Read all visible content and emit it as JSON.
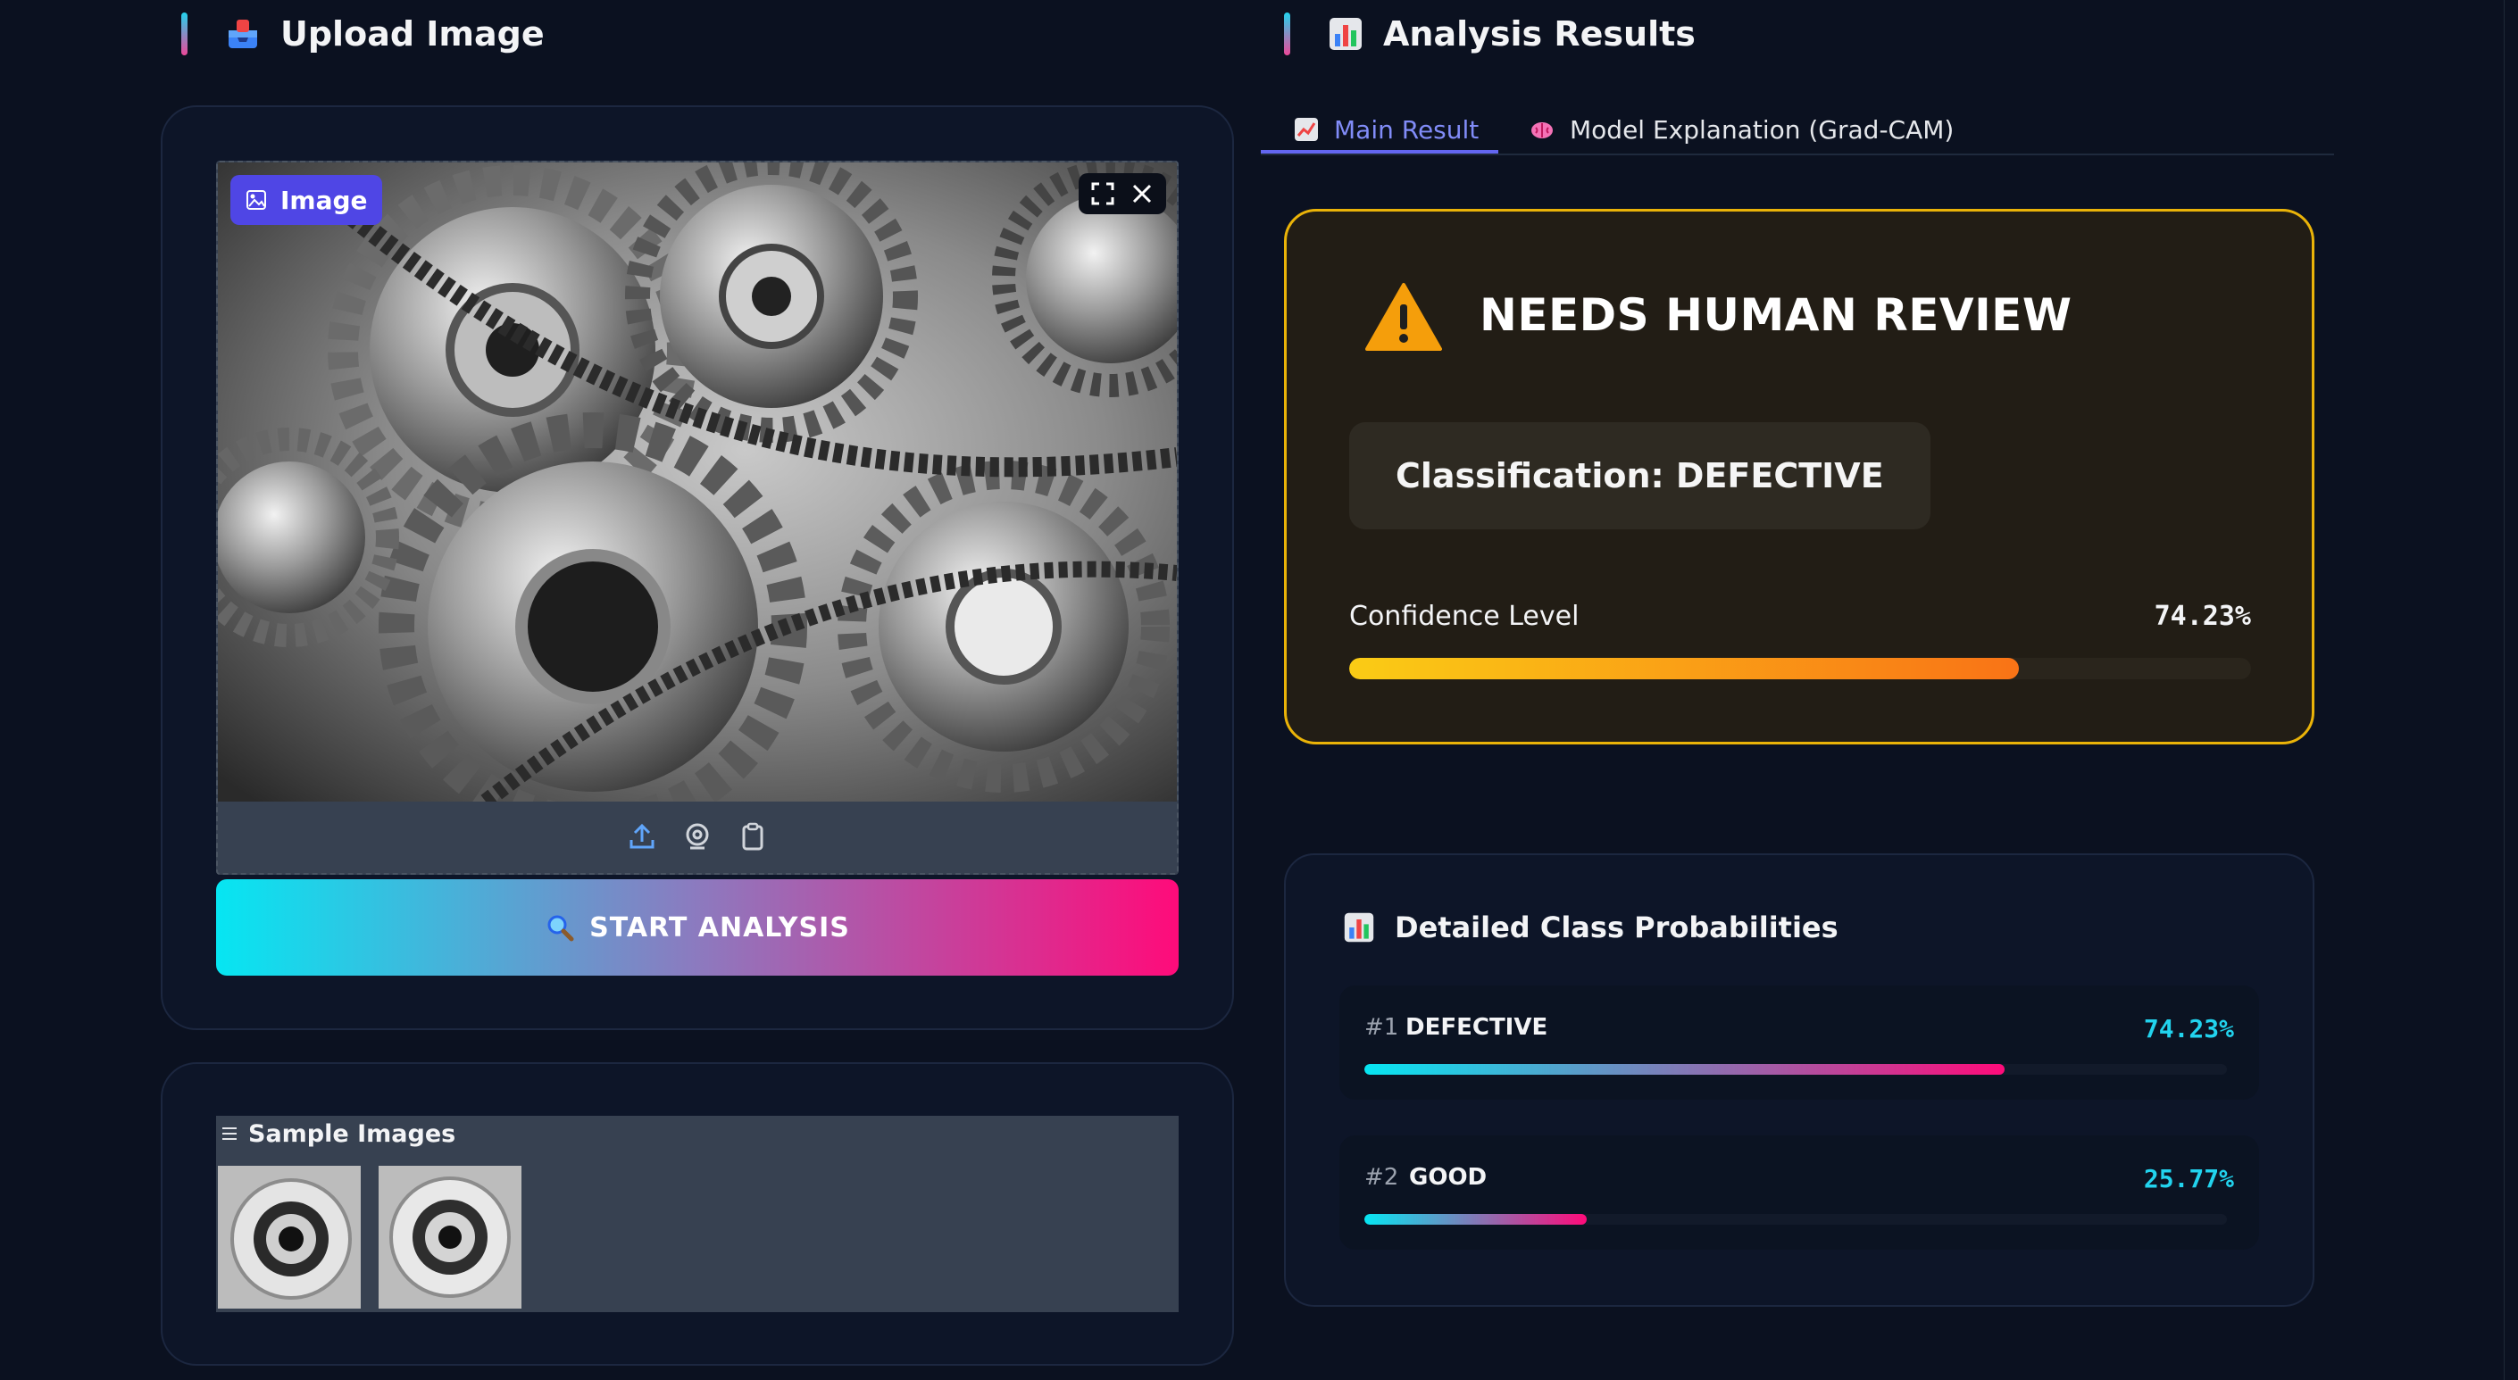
{
  "upload": {
    "title": "Upload Image",
    "image_badge": "Image",
    "start_button": "START ANALYSIS",
    "samples_label": "Sample Images"
  },
  "results": {
    "title": "Analysis Results",
    "tabs": [
      {
        "label": "Main Result",
        "active": true
      },
      {
        "label": "Model Explanation (Grad-CAM)",
        "active": false
      }
    ],
    "verdict": "NEEDS HUMAN REVIEW",
    "classification": "Classification: DEFECTIVE",
    "confidence_label": "Confidence Level",
    "confidence_text": "74.23%",
    "confidence_value": 0.7423,
    "probabilities_title": "Detailed Class Probabilities",
    "classes": [
      {
        "rank": "#1",
        "name": "DEFECTIVE",
        "percent": "74.23%",
        "value": 0.7423
      },
      {
        "rank": "#2",
        "name": "GOOD",
        "percent": "25.77%",
        "value": 0.2577
      }
    ]
  },
  "colors": {
    "accent_cyan": "#22d3ee",
    "accent_pink": "#ec4899",
    "warning_border": "#eab308",
    "tab_active": "#818cf8",
    "badge": "#4f46e5"
  },
  "icons": {
    "upload_title": "inbox-tray-icon",
    "results_title": "bar-chart-icon",
    "image_badge": "image-icon",
    "fullscreen": "fullscreen-icon",
    "close": "close-icon",
    "upload": "upload-icon",
    "webcam": "webcam-icon",
    "clipboard": "clipboard-icon",
    "search": "magnifier-icon",
    "main_tab": "chart-up-icon",
    "explain_tab": "brain-icon",
    "warning": "warning-icon",
    "samples": "list-icon"
  }
}
